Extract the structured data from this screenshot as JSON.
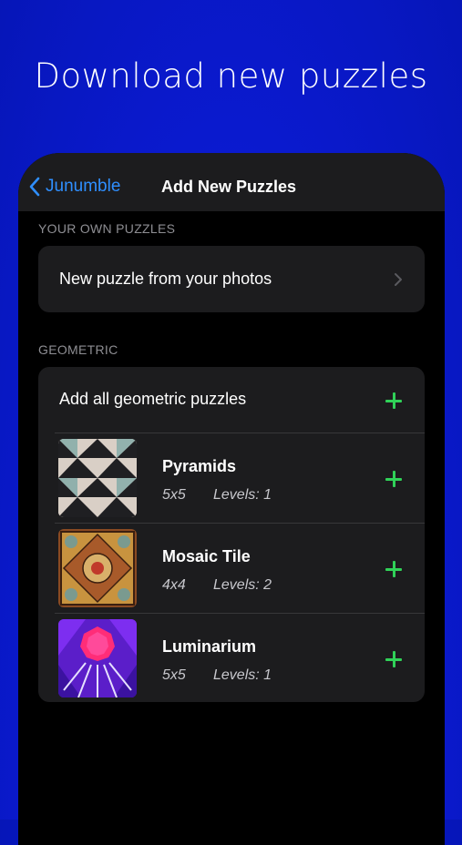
{
  "headline": "Download new puzzles",
  "nav": {
    "back_label": "Junumble",
    "title": "Add New Puzzles"
  },
  "sections": {
    "own": {
      "label": "YOUR OWN PUZZLES",
      "row_label": "New puzzle from your photos"
    },
    "geometric": {
      "label": "GEOMETRIC",
      "add_all_label": "Add all geometric puzzles",
      "puzzles": [
        {
          "name": "Pyramids",
          "size": "5x5",
          "levels": "Levels: 1",
          "thumb_icon": "pyramids-thumbnail"
        },
        {
          "name": "Mosaic Tile",
          "size": "4x4",
          "levels": "Levels: 2",
          "thumb_icon": "mosaic-tile-thumbnail"
        },
        {
          "name": "Luminarium",
          "size": "5x5",
          "levels": "Levels: 1",
          "thumb_icon": "luminarium-thumbnail"
        }
      ]
    }
  },
  "colors": {
    "accent_blue": "#2f8fff",
    "plus_green": "#30d158",
    "background_blue": "#0c1bd6"
  }
}
